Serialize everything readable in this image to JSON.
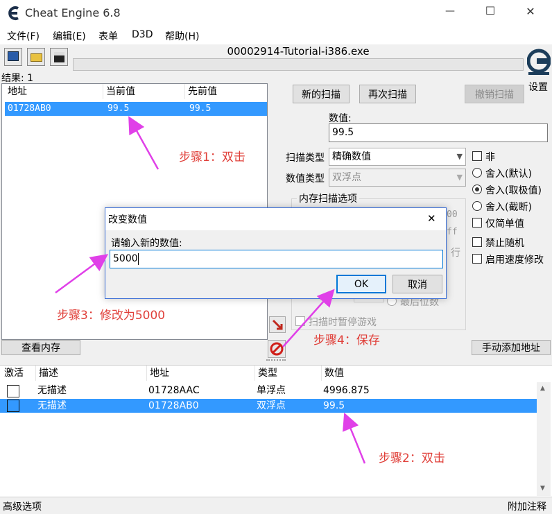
{
  "window": {
    "title": "Cheat Engine 6.8",
    "min": "—",
    "max": "☐",
    "close": "✕"
  },
  "menu": [
    "文件(F)",
    "编辑(E)",
    "表单",
    "D3D",
    "帮助(H)"
  ],
  "process_name": "00002914-Tutorial-i386.exe",
  "results_label": "结果: 1",
  "settings_label": "设置",
  "scan_results": {
    "headers": [
      "地址",
      "当前值",
      "先前值"
    ],
    "rows": [
      {
        "address": "01728AB0",
        "current": "99.5",
        "previous": "99.5"
      }
    ]
  },
  "scan_panel": {
    "new_scan": "新的扫描",
    "next_scan": "再次扫描",
    "undo_scan": "撤销扫描",
    "value_label": "数值:",
    "value": "99.5",
    "scan_type_label": "扫描类型",
    "scan_type": "精确数值",
    "value_type_label": "数值类型",
    "value_type": "双浮点",
    "mem_options_label": "内存扫描选项",
    "not_label": "非",
    "rounding": [
      "舍入(默认)",
      "舍入(取极值)",
      "舍入(截断)"
    ],
    "simple_only": "仅简单值",
    "disable_random": "禁止随机",
    "speedhack": "启用速度修改",
    "last_digits": "最后位数",
    "pause_game": "扫描时暂停游戏",
    "partial_hex_1": "00",
    "partial_hex_2": "ff",
    "partial_exec": "行"
  },
  "view_memory": "查看内存",
  "manual_add": "手动添加地址",
  "address_list": {
    "headers": [
      "激活",
      "描述",
      "地址",
      "类型",
      "数值"
    ],
    "rows": [
      {
        "active": false,
        "description": "无描述",
        "address": "01728AAC",
        "type": "单浮点",
        "value": "4996.875"
      },
      {
        "active": false,
        "description": "无描述",
        "address": "01728AB0",
        "type": "双浮点",
        "value": "99.5"
      }
    ]
  },
  "footer": {
    "left": "高级选项",
    "right": "附加注释"
  },
  "dialog": {
    "title": "改变数值",
    "prompt": "请输入新的数值:",
    "input_value": "5000",
    "ok": "OK",
    "cancel": "取消"
  },
  "annotations": {
    "step1": "步骤1：双击",
    "step2": "步骤2：双击",
    "step3": "步骤3：修改为5000",
    "step4": "步骤4：保存"
  },
  "colors": {
    "selection": "#3399ff",
    "annotation_text": "#e0403a",
    "arrow": "#e040e8",
    "dialog_border": "#3c6fd6"
  }
}
